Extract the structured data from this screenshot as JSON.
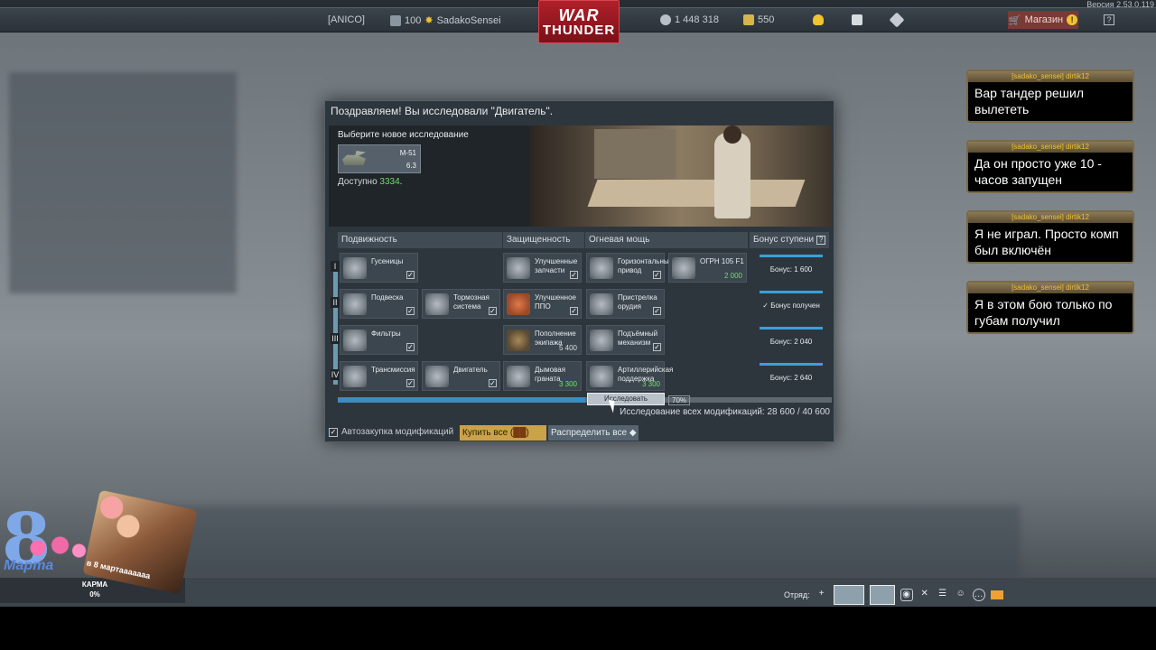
{
  "topbar": {
    "version": "Версия 2.53.0.119",
    "squadron": "[ANICO]",
    "level": "100",
    "username": "SadakoSensei",
    "logo_line1": "WAR",
    "logo_line2": "THUNDER",
    "silver_lions": "1 448 318",
    "golden_eagles": "550",
    "shop_label": "Магазин",
    "shop_alert": "!",
    "help": "?"
  },
  "modal": {
    "title": "Поздравляем! Вы исследовали \"Двигатель\".",
    "choose_label": "Выберите новое исследование",
    "vehicle_name": "M-51",
    "vehicle_br": "6.3",
    "available_label": "Доступно",
    "available_value": "3334",
    "headers": {
      "mobility": "Подвижность",
      "protection": "Защищенность",
      "firepower": "Огневая мощь",
      "bonus": "Бонус ступени",
      "bonus_help": "?"
    },
    "tiers": [
      "I",
      "II",
      "III",
      "IV"
    ],
    "mobility": [
      "Гусеницы",
      "Подвеска",
      "Тормозная система",
      "Фильтры",
      "Трансмиссия",
      "Двигатель"
    ],
    "protection": [
      "Улучшенные запчасти",
      "Улучшенное ППО",
      "Пополнение экипажа",
      "Дымовая граната"
    ],
    "protection_costs": {
      "crew": "5 400",
      "smoke": "3 300"
    },
    "firepower": [
      "Горизонтальный привод",
      "ОГРН 105 F1",
      "Пристрелка орудия",
      "Подъёмный механизм",
      "Артиллерийская поддержка"
    ],
    "firepower_costs": {
      "ogrn": "2 000",
      "artillery": "3 300"
    },
    "bonuses": [
      "Бонус: 1 600",
      "Бонус получен",
      "Бонус: 2 040",
      "Бонус: 2 640"
    ],
    "bonus_fill": [
      1.0,
      1.0,
      1.0,
      1.0
    ],
    "progress_fill": 0.5,
    "research_button": "Исследовать",
    "research_pct": "70%",
    "all_mods": "Исследование всех модификаций: 28 600 / 40 600",
    "auto_buy": "Автозакупка модификаций",
    "buy_all": "Купить все (",
    "distribute_all": "Распределить все"
  },
  "chat": [
    {
      "who": "[sadako_sensei] dirtik12",
      "msg": "Вар тандер решил вылететь"
    },
    {
      "who": "[sadako_sensei] dirtik12",
      "msg": "Да он просто уже 10 - часов запущен"
    },
    {
      "who": "[sadako_sensei] dirtik12",
      "msg": "Я не играл. Просто комп был включён"
    },
    {
      "who": "[sadako_sensei] dirtik12",
      "msg": "Я в этом бою только по губам получил"
    }
  ],
  "overlay": {
    "eight": "8",
    "mama": "Марта",
    "sparta_caption": "в 8 мартааааааа",
    "karma_label": "КАРМА",
    "karma_value": "0%"
  },
  "squad": {
    "label": "Отряд:"
  },
  "colors": {
    "accent_blue": "#3a8ec2",
    "gold_button": "#c9a24a",
    "green_value": "#6fe06a",
    "chat_name": "#f1c232"
  }
}
